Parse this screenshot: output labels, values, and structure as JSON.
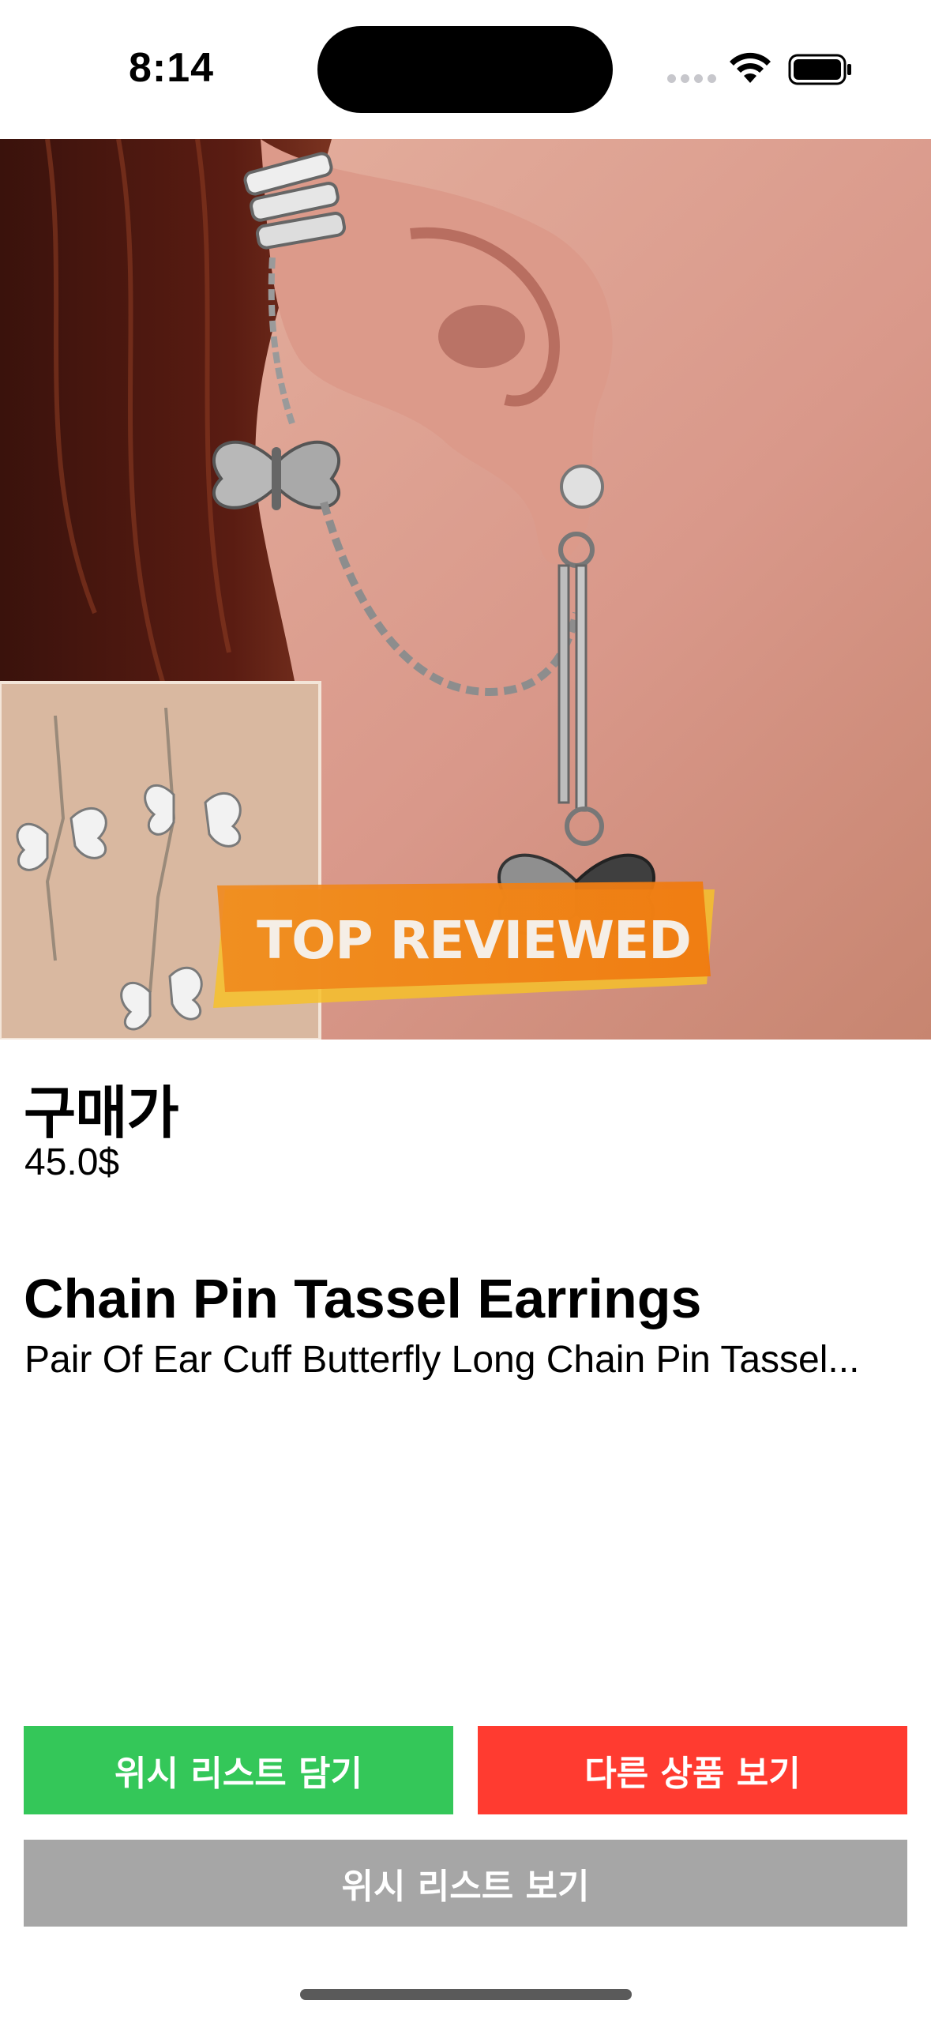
{
  "status_bar": {
    "time": "8:14"
  },
  "product": {
    "image_badge": "TOP REVIEWED",
    "price_label": "구매가",
    "price_value": "45.0$",
    "title": "Chain Pin Tassel Earrings",
    "description": "Pair Of Ear Cuff Butterfly Long Chain Pin Tassel..."
  },
  "actions": {
    "add_wishlist": "위시 리스트 담기",
    "view_other": "다른 상품 보기",
    "view_wishlist": "위시 리스트 보기"
  },
  "colors": {
    "add_wishlist_bg": "#34c759",
    "view_other_bg": "#ff3b30",
    "view_wishlist_bg": "#a6a6a6"
  }
}
